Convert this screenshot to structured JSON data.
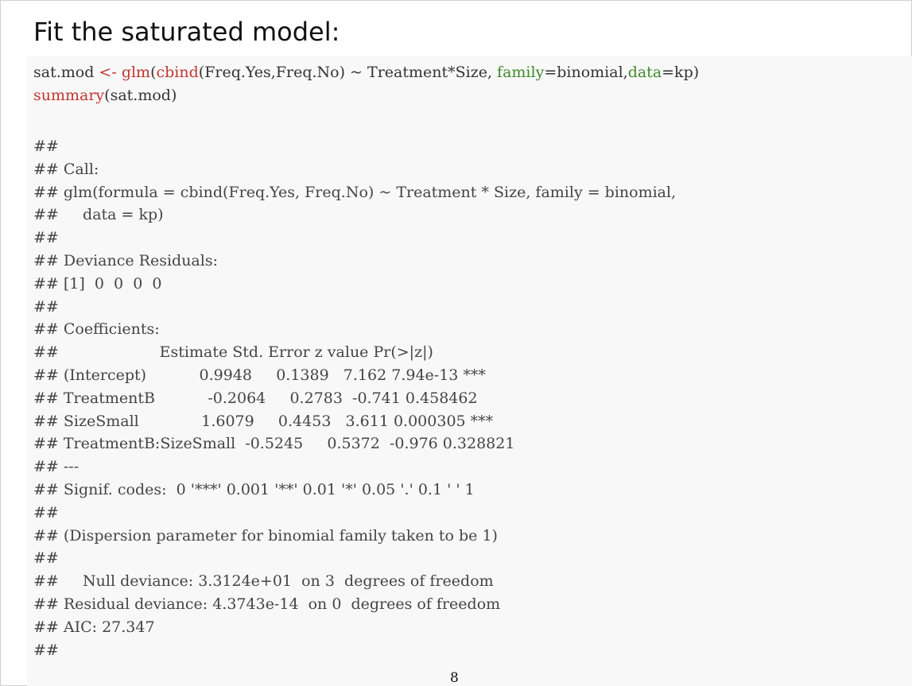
{
  "slide": {
    "heading": "Fit the saturated model:",
    "page_number": "8"
  },
  "code": {
    "line1": {
      "a": "sat.mod ",
      "b": "<-",
      "c": " ",
      "d": "glm",
      "e": "(",
      "f": "cbind",
      "g": "(Freq.Yes,Freq.No) ~ Treatment*Size, ",
      "h": "family",
      "i": "=binomial,",
      "j": "data",
      "k": "=kp)"
    },
    "line2": {
      "a": "summary",
      "b": "(sat.mod)"
    }
  },
  "output": [
    "##",
    "## Call:",
    "## glm(formula = cbind(Freq.Yes, Freq.No) ~ Treatment * Size, family = binomial,",
    "##     data = kp)",
    "##",
    "## Deviance Residuals:",
    "## [1]  0  0  0  0",
    "##",
    "## Coefficients:",
    "##                     Estimate Std. Error z value Pr(>|z|)",
    "## (Intercept)           0.9948     0.1389   7.162 7.94e-13 ***",
    "## TreatmentB           -0.2064     0.2783  -0.741 0.458462",
    "## SizeSmall             1.6079     0.4453   3.611 0.000305 ***",
    "## TreatmentB:SizeSmall  -0.5245     0.5372  -0.976 0.328821",
    "## ---",
    "## Signif. codes:  0 '***' 0.001 '**' 0.01 '*' 0.05 '.' 0.1 ' ' 1",
    "##",
    "## (Dispersion parameter for binomial family taken to be 1)",
    "##",
    "##     Null deviance: 3.3124e+01  on 3  degrees of freedom",
    "## Residual deviance: 4.3743e-14  on 0  degrees of freedom",
    "## AIC: 27.347",
    "##"
  ],
  "colors": {
    "code_background": "#f8f8f8",
    "function_red": "#c4352f",
    "argument_green": "#3f8a2a",
    "output_gray": "#444444"
  }
}
